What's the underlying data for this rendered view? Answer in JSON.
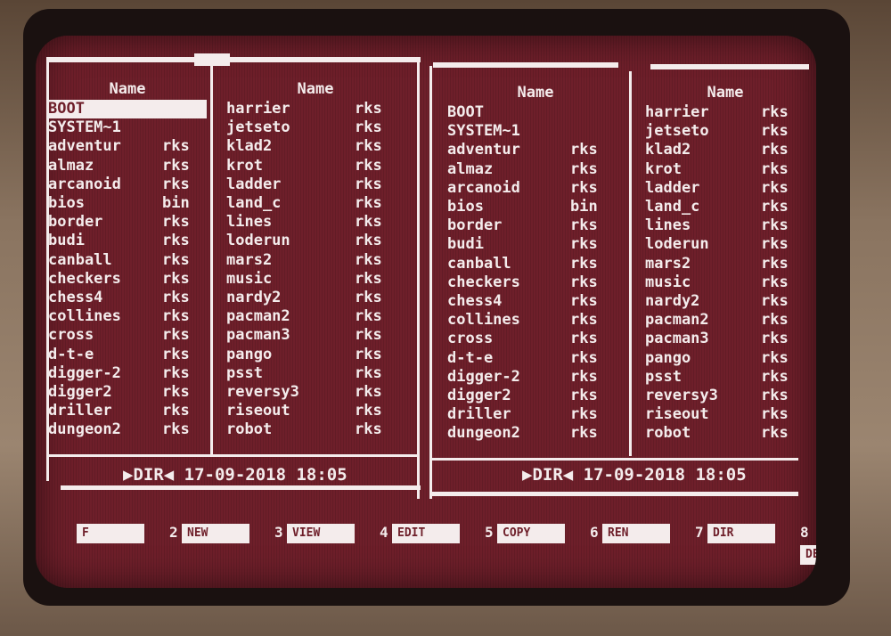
{
  "colors": {
    "screen_bg": "#6e1f2a",
    "text": "#f4ecec"
  },
  "left_panel": {
    "columns": [
      {
        "header": "Name",
        "rows": [
          {
            "name": "BOOT",
            "ext": "",
            "selected": true
          },
          {
            "name": "SYSTEM~1",
            "ext": ""
          },
          {
            "name": "adventur",
            "ext": "rks"
          },
          {
            "name": "almaz",
            "ext": "rks"
          },
          {
            "name": "arcanoid",
            "ext": "rks"
          },
          {
            "name": "bios",
            "ext": "bin"
          },
          {
            "name": "border",
            "ext": "rks"
          },
          {
            "name": "budi",
            "ext": "rks"
          },
          {
            "name": "canball",
            "ext": "rks"
          },
          {
            "name": "checkers",
            "ext": "rks"
          },
          {
            "name": "chess4",
            "ext": "rks"
          },
          {
            "name": "collines",
            "ext": "rks"
          },
          {
            "name": "cross",
            "ext": "rks"
          },
          {
            "name": "d-t-e",
            "ext": "rks"
          },
          {
            "name": "digger-2",
            "ext": "rks"
          },
          {
            "name": "digger2",
            "ext": "rks"
          },
          {
            "name": "driller",
            "ext": "rks"
          },
          {
            "name": "dungeon2",
            "ext": "rks"
          }
        ]
      },
      {
        "header": "Name",
        "rows": [
          {
            "name": "harrier",
            "ext": "rks"
          },
          {
            "name": "jetseto",
            "ext": "rks"
          },
          {
            "name": "klad2",
            "ext": "rks"
          },
          {
            "name": "krot",
            "ext": "rks"
          },
          {
            "name": "ladder",
            "ext": "rks"
          },
          {
            "name": "land_c",
            "ext": "rks"
          },
          {
            "name": "lines",
            "ext": "rks"
          },
          {
            "name": "loderun",
            "ext": "rks"
          },
          {
            "name": "mars2",
            "ext": "rks"
          },
          {
            "name": "music",
            "ext": "rks"
          },
          {
            "name": "nardy2",
            "ext": "rks"
          },
          {
            "name": "pacman2",
            "ext": "rks"
          },
          {
            "name": "pacman3",
            "ext": "rks"
          },
          {
            "name": "pango",
            "ext": "rks"
          },
          {
            "name": "psst",
            "ext": "rks"
          },
          {
            "name": "reversy3",
            "ext": "rks"
          },
          {
            "name": "riseout",
            "ext": "rks"
          },
          {
            "name": "robot",
            "ext": "rks"
          }
        ]
      }
    ],
    "status": "▶DIR◀ 17-09-2018 18:05"
  },
  "right_panel": {
    "columns": [
      {
        "header": "Name",
        "rows": [
          {
            "name": "BOOT",
            "ext": ""
          },
          {
            "name": "SYSTEM~1",
            "ext": ""
          },
          {
            "name": "adventur",
            "ext": "rks"
          },
          {
            "name": "almaz",
            "ext": "rks"
          },
          {
            "name": "arcanoid",
            "ext": "rks"
          },
          {
            "name": "bios",
            "ext": "bin"
          },
          {
            "name": "border",
            "ext": "rks"
          },
          {
            "name": "budi",
            "ext": "rks"
          },
          {
            "name": "canball",
            "ext": "rks"
          },
          {
            "name": "checkers",
            "ext": "rks"
          },
          {
            "name": "chess4",
            "ext": "rks"
          },
          {
            "name": "collines",
            "ext": "rks"
          },
          {
            "name": "cross",
            "ext": "rks"
          },
          {
            "name": "d-t-e",
            "ext": "rks"
          },
          {
            "name": "digger-2",
            "ext": "rks"
          },
          {
            "name": "digger2",
            "ext": "rks"
          },
          {
            "name": "driller",
            "ext": "rks"
          },
          {
            "name": "dungeon2",
            "ext": "rks"
          }
        ]
      },
      {
        "header": "Name",
        "rows": [
          {
            "name": "harrier",
            "ext": "rks"
          },
          {
            "name": "jetseto",
            "ext": "rks"
          },
          {
            "name": "klad2",
            "ext": "rks"
          },
          {
            "name": "krot",
            "ext": "rks"
          },
          {
            "name": "ladder",
            "ext": "rks"
          },
          {
            "name": "land_c",
            "ext": "rks"
          },
          {
            "name": "lines",
            "ext": "rks"
          },
          {
            "name": "loderun",
            "ext": "rks"
          },
          {
            "name": "mars2",
            "ext": "rks"
          },
          {
            "name": "music",
            "ext": "rks"
          },
          {
            "name": "nardy2",
            "ext": "rks"
          },
          {
            "name": "pacman2",
            "ext": "rks"
          },
          {
            "name": "pacman3",
            "ext": "rks"
          },
          {
            "name": "pango",
            "ext": "rks"
          },
          {
            "name": "psst",
            "ext": "rks"
          },
          {
            "name": "reversy3",
            "ext": "rks"
          },
          {
            "name": "riseout",
            "ext": "rks"
          },
          {
            "name": "robot",
            "ext": "rks"
          }
        ]
      }
    ],
    "status": "▶DIR◀ 17-09-2018 18:05"
  },
  "function_keys": [
    {
      "num": "",
      "label": "F"
    },
    {
      "num": "2",
      "label": "NEW"
    },
    {
      "num": "3",
      "label": "VIEW"
    },
    {
      "num": "4",
      "label": "EDIT"
    },
    {
      "num": "5",
      "label": "COPY"
    },
    {
      "num": "6",
      "label": "REN"
    },
    {
      "num": "7",
      "label": "DIR"
    },
    {
      "num": "8",
      "label": "DEL"
    }
  ]
}
